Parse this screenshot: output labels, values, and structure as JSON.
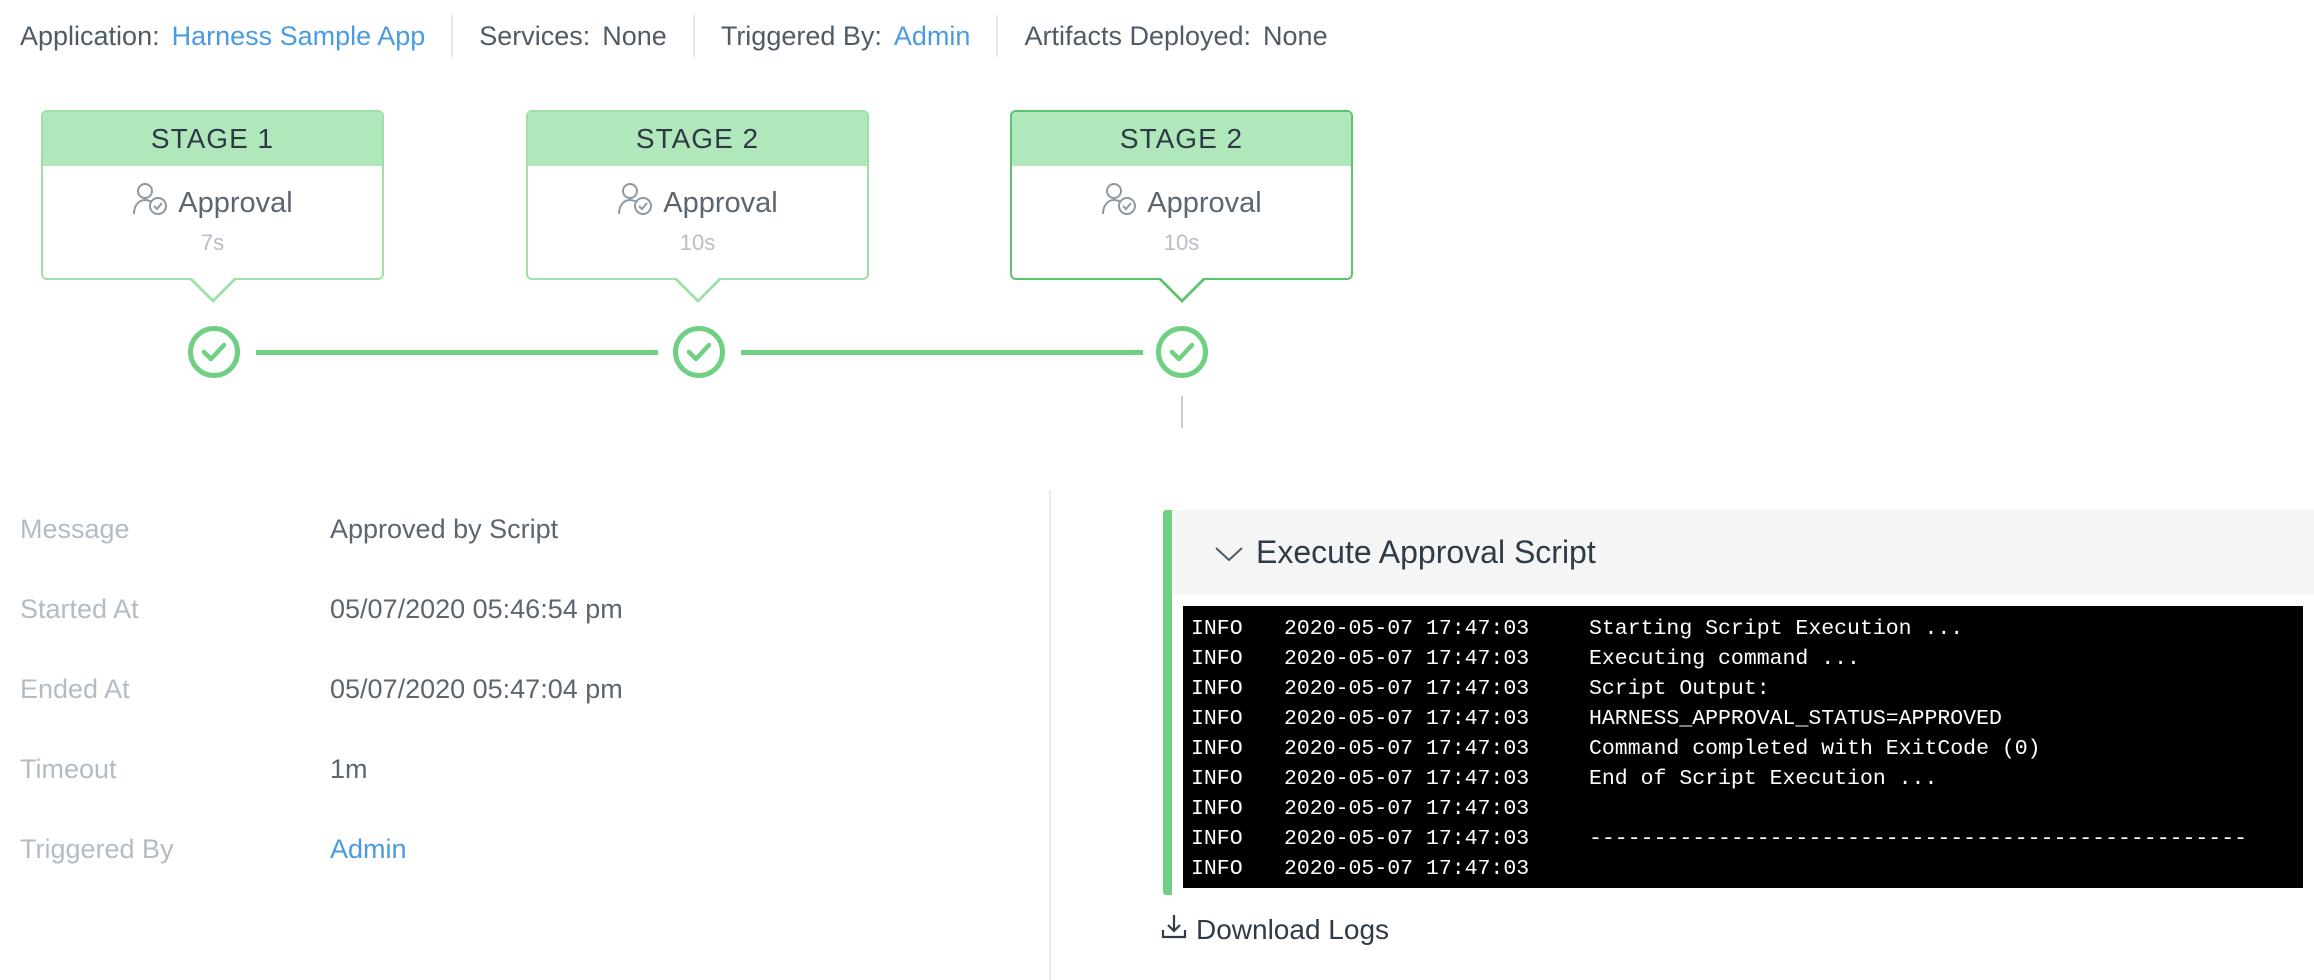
{
  "header": {
    "application_label": "Application:",
    "application_value": "Harness Sample App",
    "services_label": "Services:",
    "services_value": "None",
    "triggered_label": "Triggered By:",
    "triggered_value": "Admin",
    "artifacts_label": "Artifacts Deployed:",
    "artifacts_value": "None"
  },
  "stages": [
    {
      "title": "STAGE 1",
      "step": "Approval",
      "duration": "7s",
      "status": "success"
    },
    {
      "title": "STAGE 2",
      "step": "Approval",
      "duration": "10s",
      "status": "success"
    },
    {
      "title": "STAGE 2",
      "step": "Approval",
      "duration": "10s",
      "status": "success",
      "selected": true
    }
  ],
  "details": {
    "message_label": "Message",
    "message_value": "Approved by Script",
    "started_label": "Started At",
    "started_value": "05/07/2020 05:46:54 pm",
    "ended_label": "Ended At",
    "ended_value": "05/07/2020 05:47:04 pm",
    "timeout_label": "Timeout",
    "timeout_value": "1m",
    "triggered_label": "Triggered By",
    "triggered_value": "Admin"
  },
  "log_panel": {
    "title": "Execute Approval Script",
    "lines": [
      {
        "level": "INFO",
        "ts": "2020-05-07 17:47:03",
        "msg": "Starting Script Execution ..."
      },
      {
        "level": "INFO",
        "ts": "2020-05-07 17:47:03",
        "msg": "Executing command ..."
      },
      {
        "level": "INFO",
        "ts": "2020-05-07 17:47:03",
        "msg": "Script Output:"
      },
      {
        "level": "INFO",
        "ts": "2020-05-07 17:47:03",
        "msg": "HARNESS_APPROVAL_STATUS=APPROVED"
      },
      {
        "level": "INFO",
        "ts": "2020-05-07 17:47:03",
        "msg": "Command completed with ExitCode (0)"
      },
      {
        "level": "INFO",
        "ts": "2020-05-07 17:47:03",
        "msg": "End of Script Execution ..."
      },
      {
        "level": "INFO",
        "ts": "2020-05-07 17:47:03",
        "msg": ""
      },
      {
        "level": "INFO",
        "ts": "2020-05-07 17:47:03",
        "msg": "---------------------------------------------------"
      },
      {
        "level": "INFO",
        "ts": "2020-05-07 17:47:03",
        "msg": ""
      }
    ],
    "download_label": "Download Logs"
  },
  "colors": {
    "accent_green": "#6fd082",
    "stage_header": "#b0e8bc",
    "link_blue": "#4a9be0"
  },
  "icons": {
    "approval": "user-check-icon",
    "success": "check-circle-icon",
    "collapse": "chevron-down-icon",
    "download": "download-icon"
  }
}
